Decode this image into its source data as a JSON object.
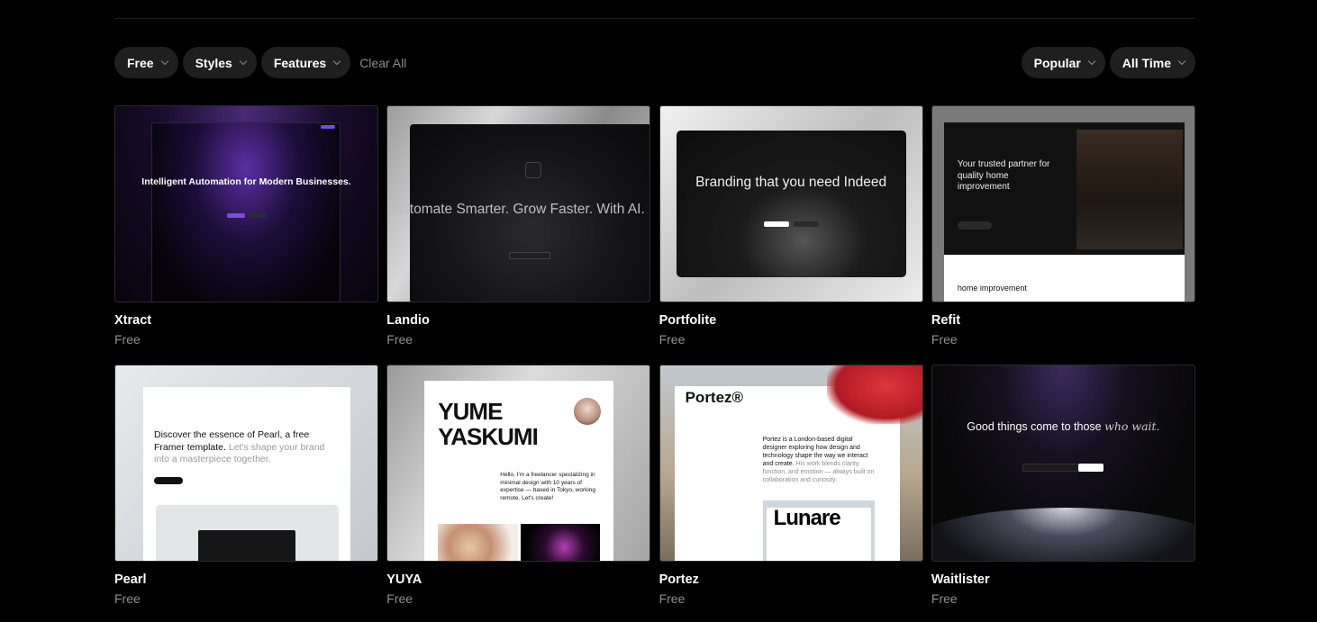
{
  "filters": {
    "left": [
      {
        "label": "Free",
        "icon": "chevron-down-icon"
      },
      {
        "label": "Styles",
        "icon": "chevron-down-icon"
      },
      {
        "label": "Features",
        "icon": "chevron-down-icon"
      }
    ],
    "clear_label": "Clear All",
    "right": [
      {
        "label": "Popular",
        "icon": "chevron-down-icon"
      },
      {
        "label": "All Time",
        "icon": "chevron-down-icon"
      }
    ]
  },
  "templates": [
    {
      "name": "Xtract",
      "price": "Free",
      "preview_heading": "Intelligent Automation for Modern Businesses."
    },
    {
      "name": "Landio",
      "price": "Free",
      "preview_heading": "Automate Smarter. Grow Faster. With AI."
    },
    {
      "name": "Portfolite",
      "price": "Free",
      "preview_heading": "Branding that you need Indeed"
    },
    {
      "name": "Refit",
      "price": "Free",
      "preview_heading": "Your trusted partner for quality home improvement",
      "preview_subheading": "home improvement"
    },
    {
      "name": "Pearl",
      "price": "Free",
      "preview_heading": "Discover the essence of Pearl, a free Framer template.",
      "preview_heading_muted": "Let's shape your brand into a masterpiece together."
    },
    {
      "name": "YUYA",
      "price": "Free",
      "preview_heading": "YUME YASKUMI",
      "preview_text": "Hello, I'm a freelancer specializing in minimal design with 10 years of expertise — based in Tokyo, working remote. Let's create!"
    },
    {
      "name": "Portez",
      "price": "Free",
      "preview_heading": "Portez®",
      "preview_text": "Portez is a London-based digital designer exploring how design and technology shape the way we interact and create.",
      "preview_text_muted": "His work blends clarity, function, and emotion — always built on collaboration and curiosity.",
      "preview_image_text": "Lunare"
    },
    {
      "name": "Waitlister",
      "price": "Free",
      "preview_heading": "Good things come to those",
      "preview_heading_italic": "who wait."
    }
  ]
}
